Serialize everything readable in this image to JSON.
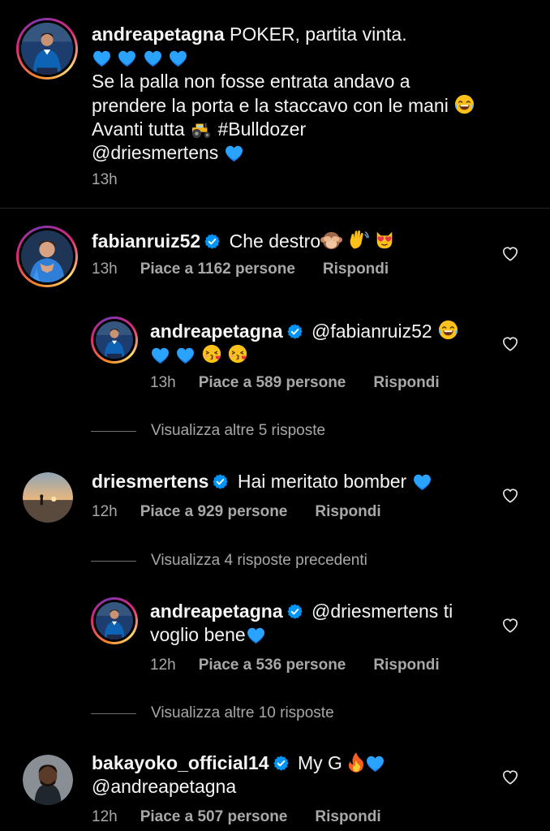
{
  "caption": {
    "username": "andreapetagna",
    "line1": "POKER, partita vinta.",
    "line3": "Se la palla non fosse entrata andavo a",
    "line4": "prendere la porta e la staccavo con le mani",
    "line5_prefix": "Avanti tutta",
    "line5_hashtag": "#Bulldozer",
    "line6_mention": "@driesmertens",
    "time": "13h"
  },
  "comments": [
    {
      "username": "fabianruiz52",
      "text": "Che destro",
      "time": "13h",
      "likes": "Piace a 1162 persone",
      "reply": "Rispondi"
    },
    {
      "username": "andreapetagna",
      "mention": "@fabianruiz52",
      "time": "13h",
      "likes": "Piace a 589 persone",
      "reply": "Rispondi"
    },
    {
      "username": "driesmertens",
      "text": "Hai meritato bomber",
      "time": "12h",
      "likes": "Piace a 929 persone",
      "reply": "Rispondi"
    },
    {
      "username": "andreapetagna",
      "mention": "@driesmertens",
      "text_line1_rest": "ti",
      "text_line2": "voglio bene",
      "time": "12h",
      "likes": "Piace a 536 persone",
      "reply": "Rispondi"
    },
    {
      "username": "bakayoko_official14",
      "text": "My G",
      "text_line2": "@andreapetagna",
      "time": "12h",
      "likes": "Piace a 507 persone",
      "reply": "Rispondi"
    }
  ],
  "view_more": {
    "first": "Visualizza altre 5 risposte",
    "previous": "Visualizza 4 risposte precedenti",
    "second": "Visualizza altre 10 risposte"
  },
  "colors": {
    "background": "#000000",
    "text": "#f5f5f5",
    "secondary": "#a8a8a8",
    "verified": "#0095f6",
    "heart_emoji": "#1f8fff"
  },
  "icons": [
    "verified-badge-icon",
    "heart-outline-icon",
    "blue-heart-emoji",
    "laughing-emoji",
    "tractor-emoji",
    "see-no-evil-monkey-emoji",
    "waving-hand-emoji",
    "heart-eyes-cat-emoji",
    "kissing-face-emoji",
    "fire-emoji"
  ]
}
